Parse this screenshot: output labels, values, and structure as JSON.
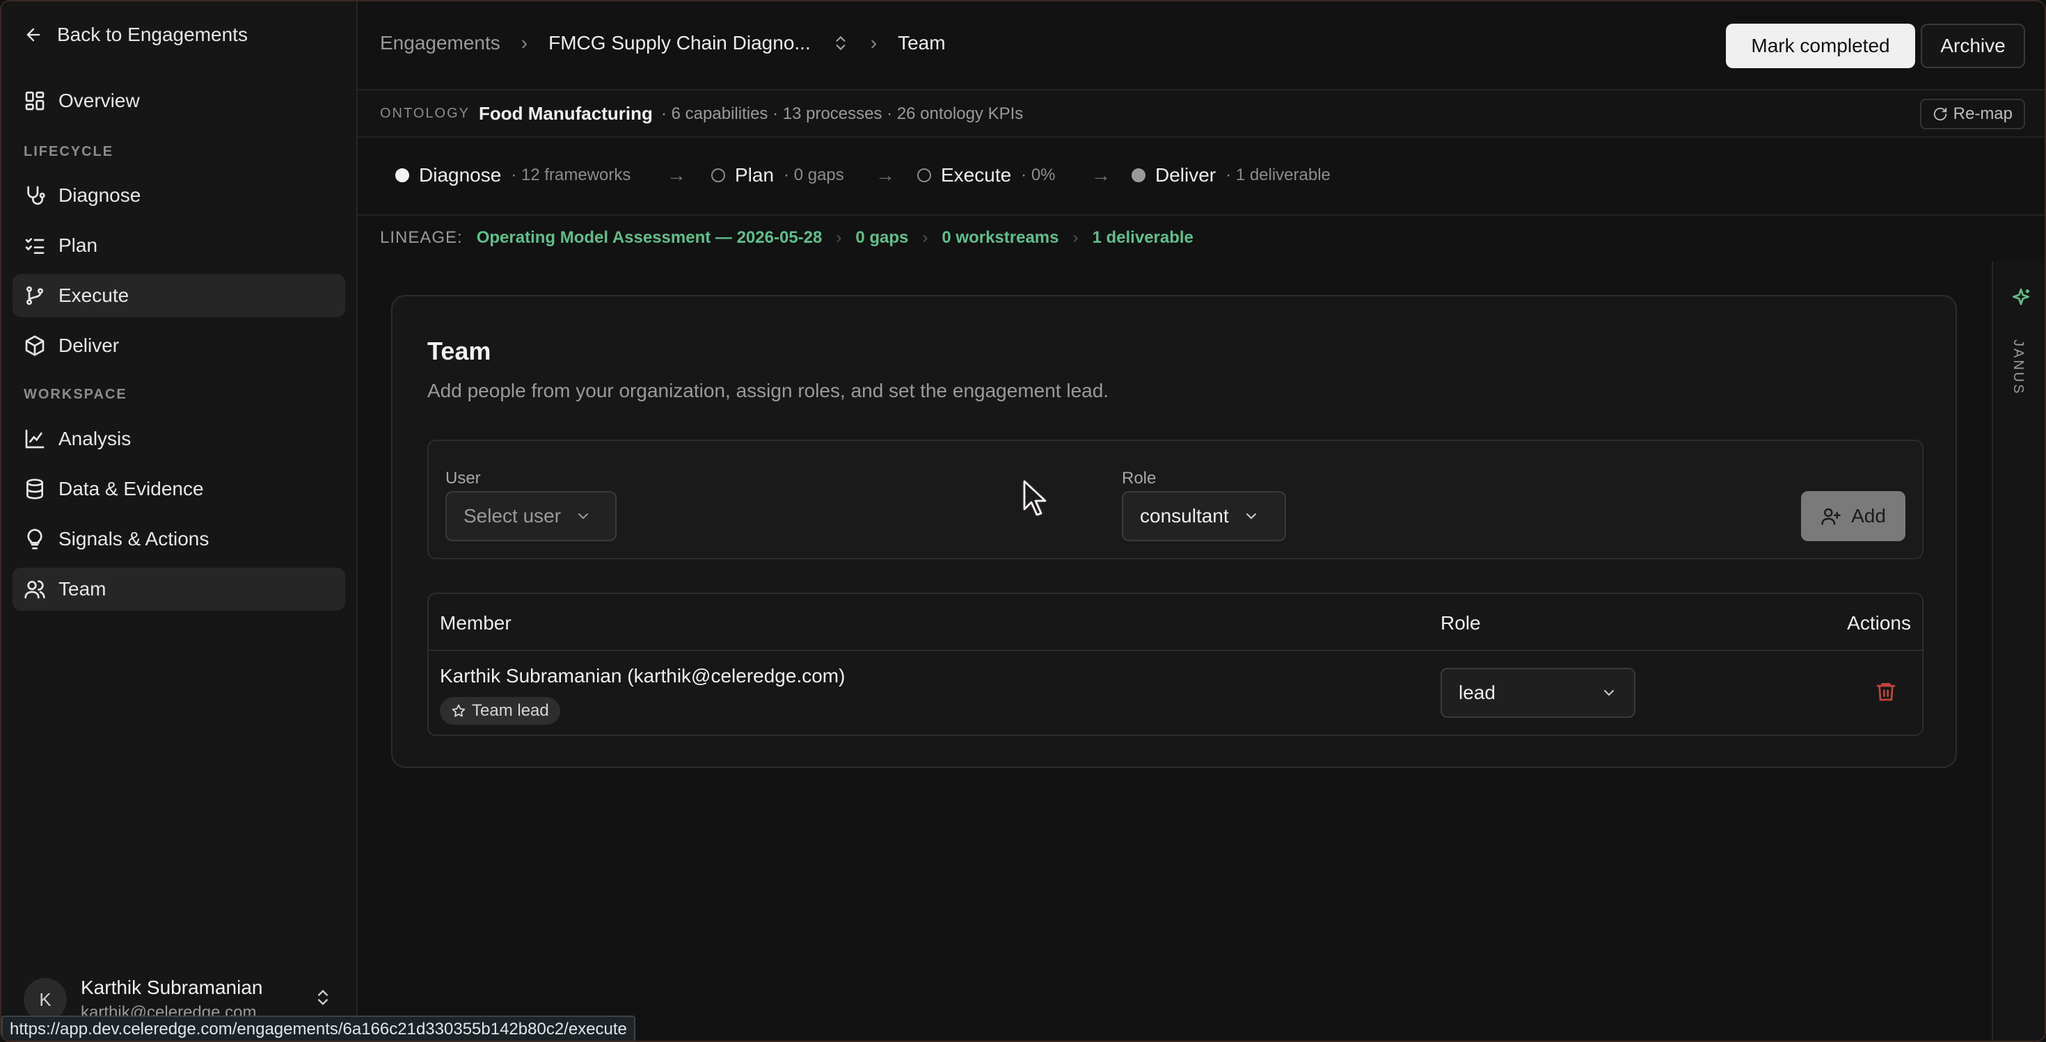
{
  "sidebar": {
    "back_label": "Back to Engagements",
    "overview": "Overview",
    "lifecycle_label": "LIFECYCLE",
    "lifecycle_items": [
      "Diagnose",
      "Plan",
      "Execute",
      "Deliver"
    ],
    "workspace_label": "WORKSPACE",
    "workspace_items": [
      "Analysis",
      "Data & Evidence",
      "Signals & Actions",
      "Team"
    ],
    "user": {
      "initial": "K",
      "name": "Karthik Subramanian",
      "email": "karthik@celeredge.com"
    }
  },
  "status_url": "https://app.dev.celeredge.com/engagements/6a166c21d330355b142b80c2/execute",
  "header": {
    "breadcrumb_root": "Engagements",
    "breadcrumb_engagement": "FMCG Supply Chain Diagno...",
    "breadcrumb_page": "Team",
    "mark_completed": "Mark completed",
    "archive": "Archive"
  },
  "ontology": {
    "label": "ONTOLOGY",
    "name": "Food Manufacturing",
    "meta": "· 6 capabilities · 13 processes · 26 ontology KPIs",
    "remap": "Re-map"
  },
  "lifecycle": [
    {
      "name": "Diagnose",
      "meta": "· 12 frameworks"
    },
    {
      "name": "Plan",
      "meta": "· 0 gaps"
    },
    {
      "name": "Execute",
      "meta": "· 0%"
    },
    {
      "name": "Deliver",
      "meta": "· 1 deliverable"
    }
  ],
  "lineage": {
    "label": "LINEAGE:",
    "items": [
      "Operating Model Assessment — 2026-05-28",
      "0 gaps",
      "0 workstreams",
      "1 deliverable"
    ]
  },
  "right_rail": {
    "label": "JANUS"
  },
  "team": {
    "title": "Team",
    "description": "Add people from your organization, assign roles, and set the engagement lead.",
    "user_label": "User",
    "user_placeholder": "Select user",
    "role_label": "Role",
    "role_value": "consultant",
    "add_label": "Add",
    "columns": {
      "member": "Member",
      "role": "Role",
      "actions": "Actions"
    },
    "members": [
      {
        "name": "Karthik Subramanian (karthik@celeredge.com)",
        "badge": "Team lead",
        "role": "lead"
      }
    ]
  },
  "colors": {
    "accent_green": "#5fbf8a",
    "danger_red": "#c0443c"
  }
}
